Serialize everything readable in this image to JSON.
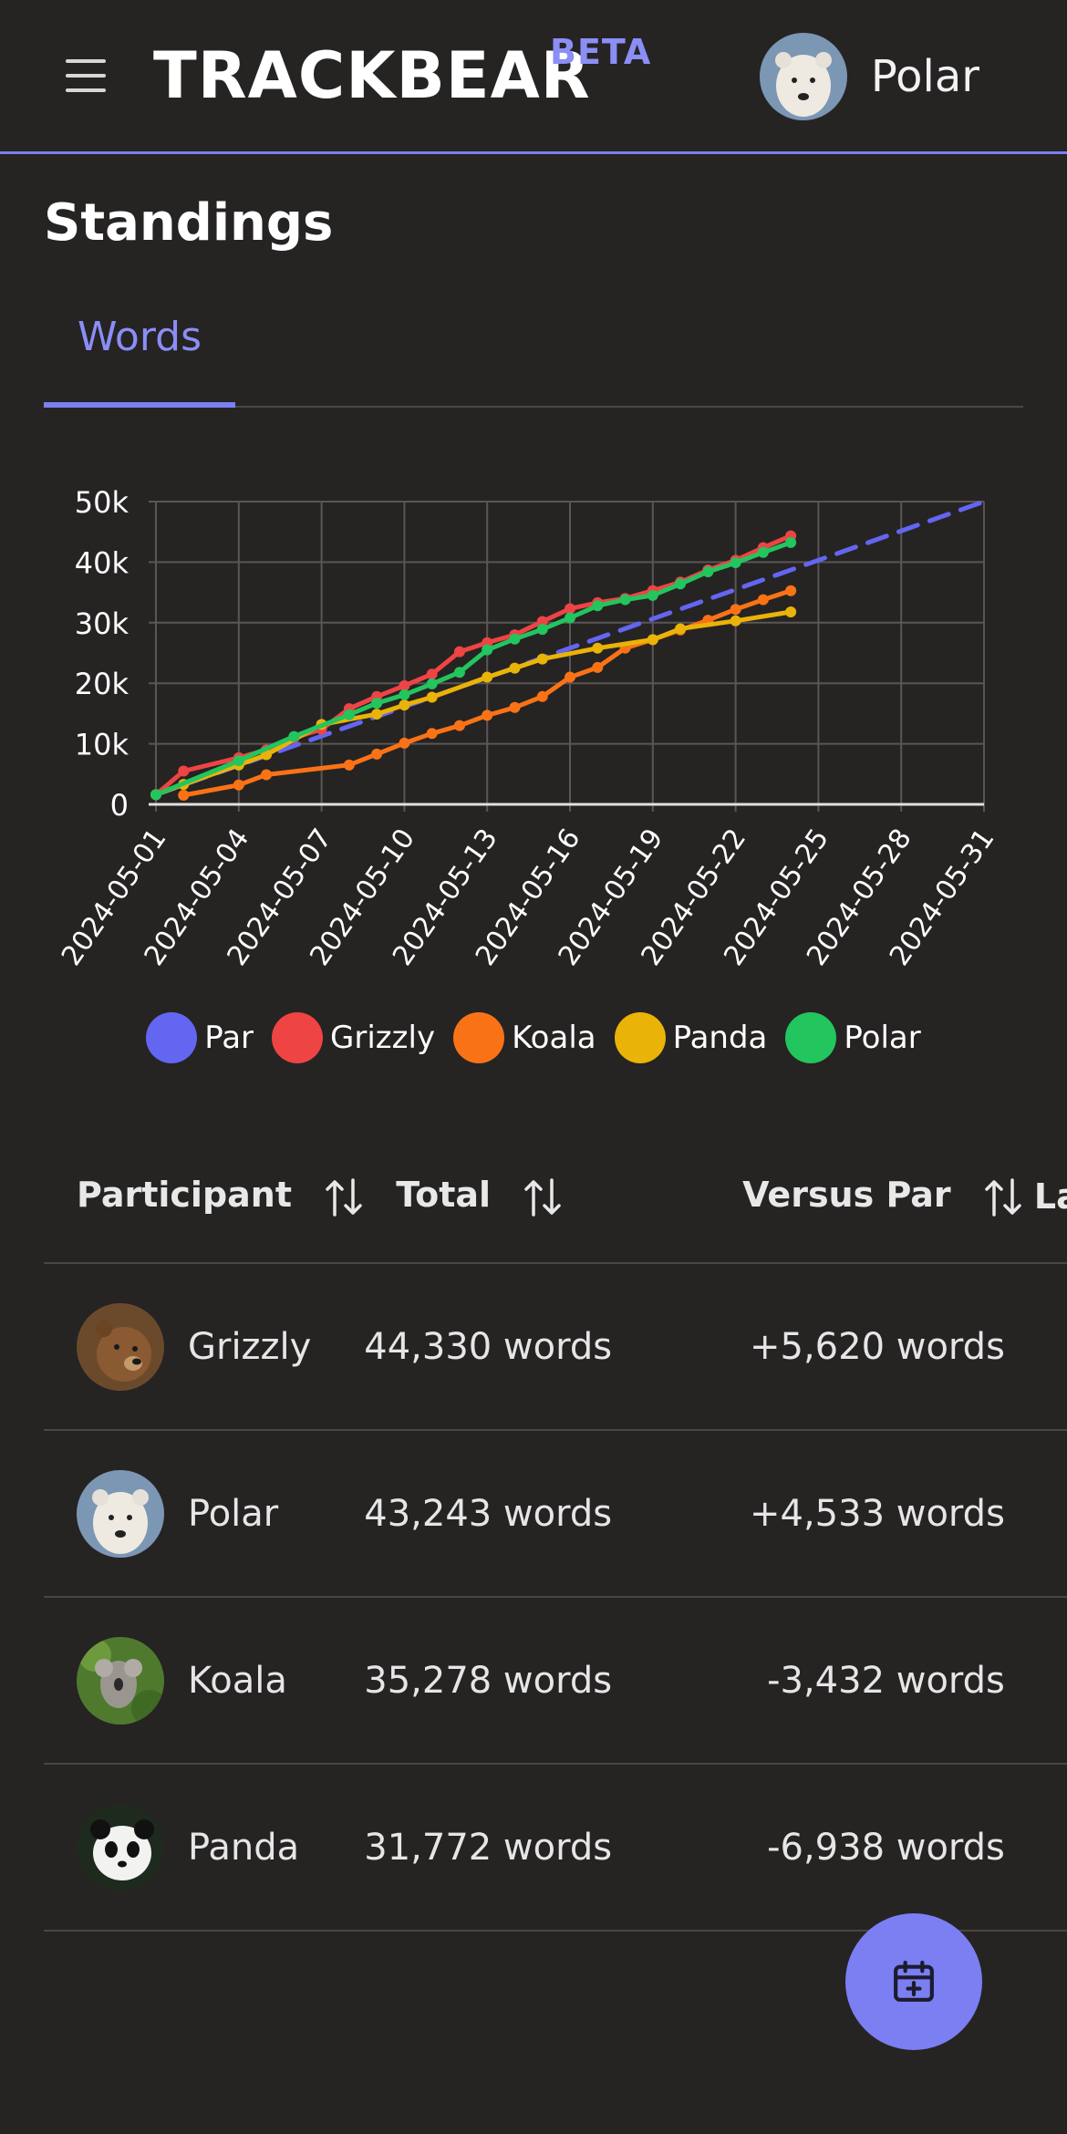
{
  "header": {
    "brand": "TRACKBEAR",
    "brand_badge": "BETA",
    "user_name": "Polar"
  },
  "page": {
    "title": "Standings",
    "tabs": [
      {
        "label": "Words"
      }
    ]
  },
  "chart_data": {
    "type": "line",
    "title": "",
    "xlabel": "",
    "ylabel": "",
    "x_ticks": [
      "2024-05-01",
      "2024-05-04",
      "2024-05-07",
      "2024-05-10",
      "2024-05-13",
      "2024-05-16",
      "2024-05-19",
      "2024-05-22",
      "2024-05-25",
      "2024-05-28",
      "2024-05-31"
    ],
    "y_ticks": [
      "0",
      "10k",
      "20k",
      "30k",
      "40k",
      "50k"
    ],
    "xlim": [
      "2024-05-01",
      "2024-05-31"
    ],
    "ylim": [
      0,
      50000
    ],
    "grid": true,
    "legend_position": "bottom",
    "series": [
      {
        "name": "Par",
        "color": "#6366f1",
        "dashed": true,
        "markers": false,
        "x": [
          "2024-05-01",
          "2024-05-31"
        ],
        "values": [
          1600,
          50000
        ]
      },
      {
        "name": "Grizzly",
        "color": "#ef4444",
        "dashed": false,
        "markers": true,
        "x": [
          "2024-05-01",
          "2024-05-02",
          "2024-05-04",
          "2024-05-05",
          "2024-05-06",
          "2024-05-07",
          "2024-05-08",
          "2024-05-09",
          "2024-05-10",
          "2024-05-11",
          "2024-05-12",
          "2024-05-13",
          "2024-05-14",
          "2024-05-15",
          "2024-05-16",
          "2024-05-17",
          "2024-05-18",
          "2024-05-19",
          "2024-05-20",
          "2024-05-21",
          "2024-05-22",
          "2024-05-23",
          "2024-05-24"
        ],
        "values": [
          1600,
          5500,
          7700,
          9000,
          11000,
          12400,
          15800,
          17800,
          19600,
          21500,
          25200,
          26700,
          28000,
          30200,
          32300,
          33300,
          34000,
          35300,
          36700,
          38700,
          40300,
          42400,
          44330
        ]
      },
      {
        "name": "Koala",
        "color": "#f97316",
        "dashed": false,
        "markers": true,
        "x": [
          "2024-05-02",
          "2024-05-04",
          "2024-05-05",
          "2024-05-08",
          "2024-05-09",
          "2024-05-10",
          "2024-05-11",
          "2024-05-12",
          "2024-05-13",
          "2024-05-14",
          "2024-05-15",
          "2024-05-16",
          "2024-05-17",
          "2024-05-18",
          "2024-05-19",
          "2024-05-20",
          "2024-05-21",
          "2024-05-22",
          "2024-05-23",
          "2024-05-24"
        ],
        "values": [
          1500,
          3200,
          4900,
          6500,
          8300,
          10100,
          11700,
          13000,
          14700,
          16000,
          17800,
          21000,
          22600,
          25800,
          27200,
          28800,
          30400,
          32200,
          33800,
          35278
        ]
      },
      {
        "name": "Panda",
        "color": "#eab308",
        "dashed": false,
        "markers": true,
        "x": [
          "2024-05-01",
          "2024-05-02",
          "2024-05-04",
          "2024-05-05",
          "2024-05-07",
          "2024-05-09",
          "2024-05-10",
          "2024-05-11",
          "2024-05-13",
          "2024-05-14",
          "2024-05-15",
          "2024-05-17",
          "2024-05-19",
          "2024-05-20",
          "2024-05-22",
          "2024-05-24"
        ],
        "values": [
          1600,
          3300,
          6500,
          8200,
          13200,
          14900,
          16400,
          17700,
          21000,
          22500,
          24000,
          25800,
          27200,
          29000,
          30300,
          31772
        ]
      },
      {
        "name": "Polar",
        "color": "#22c55e",
        "dashed": false,
        "markers": true,
        "x": [
          "2024-05-01",
          "2024-05-04",
          "2024-05-06",
          "2024-05-08",
          "2024-05-09",
          "2024-05-10",
          "2024-05-11",
          "2024-05-12",
          "2024-05-13",
          "2024-05-14",
          "2024-05-15",
          "2024-05-16",
          "2024-05-17",
          "2024-05-18",
          "2024-05-19",
          "2024-05-20",
          "2024-05-21",
          "2024-05-22",
          "2024-05-23",
          "2024-05-24"
        ],
        "values": [
          1600,
          7200,
          11200,
          14800,
          16700,
          18100,
          19900,
          21800,
          25500,
          27300,
          28900,
          30800,
          32800,
          33800,
          34500,
          36400,
          38400,
          39900,
          41600,
          43243
        ]
      }
    ]
  },
  "table": {
    "columns": [
      {
        "label": "Participant"
      },
      {
        "label": "Total"
      },
      {
        "label": "Versus Par"
      },
      {
        "label": "La"
      }
    ],
    "rows": [
      {
        "name": "Grizzly",
        "total": "44,330 words",
        "versus_par": "+5,620 words"
      },
      {
        "name": "Polar",
        "total": "43,243 words",
        "versus_par": "+4,533 words"
      },
      {
        "name": "Koala",
        "total": "35,278 words",
        "versus_par": "-3,432 words"
      },
      {
        "name": "Panda",
        "total": "31,772 words",
        "versus_par": "-6,938 words"
      }
    ]
  },
  "icons": {
    "menu": "hamburger-menu-icon",
    "sort": "sort-arrows-icon",
    "fab": "calendar-plus-icon"
  },
  "colors": {
    "accent": "#7b7ff2",
    "background": "#262323"
  }
}
